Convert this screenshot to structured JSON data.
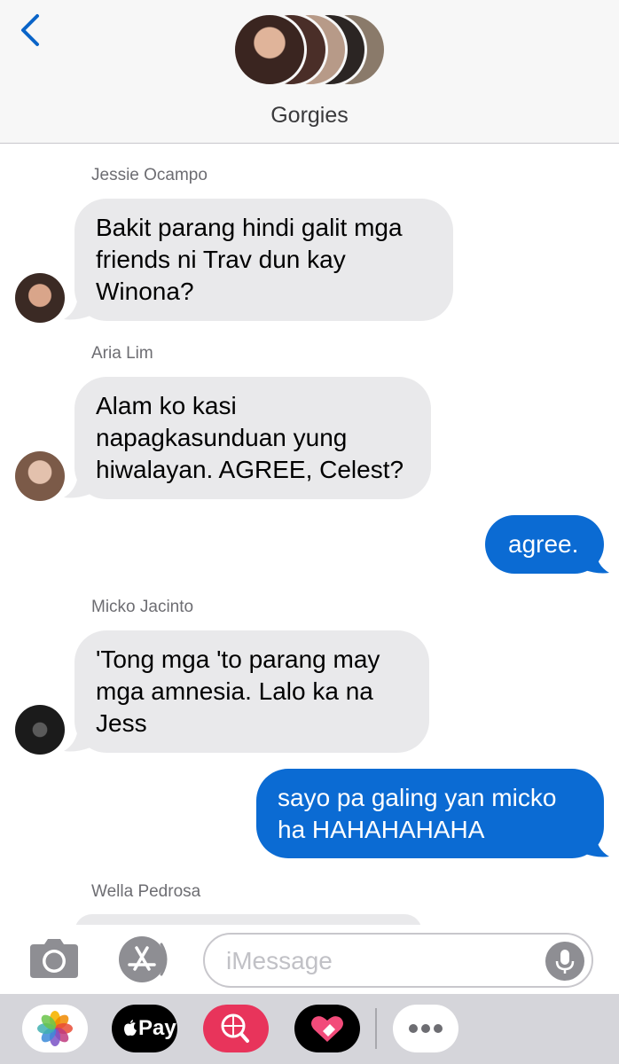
{
  "header": {
    "group_name": "Gorgies"
  },
  "messages": [
    {
      "type": "incoming",
      "sender": "Jessie Ocampo",
      "lines": [
        "Bakit parang hindi galit mga",
        "friends ni Trav dun kay",
        "Winona?"
      ]
    },
    {
      "type": "incoming",
      "sender": "Aria Lim",
      "lines": [
        "Alam ko kasi",
        "napagkasunduan yung",
        "hiwalayan. AGREE, Celest?"
      ]
    },
    {
      "type": "outgoing",
      "lines": [
        "agree."
      ]
    },
    {
      "type": "incoming",
      "sender": "Micko Jacinto",
      "lines": [
        "'Tong mga 'to parang may",
        "mga amnesia. Lalo ka na",
        "Jess"
      ]
    },
    {
      "type": "outgoing",
      "lines": [
        "sayo pa galing yan micko",
        "ha HAHAHAHAHA"
      ]
    },
    {
      "type": "incoming",
      "sender": "Wella Pedrosa",
      "lines": []
    }
  ],
  "composer": {
    "placeholder": "iMessage"
  },
  "drawer": {
    "apps": [
      "photos-app",
      "apple-pay-app",
      "search-images-app",
      "digital-touch-app",
      "more-apps"
    ],
    "pay_label": "Pay"
  },
  "colors": {
    "outgoing_bubble": "#0b6bd3",
    "incoming_bubble": "#e9e9eb",
    "accent": "#0a64c8"
  }
}
